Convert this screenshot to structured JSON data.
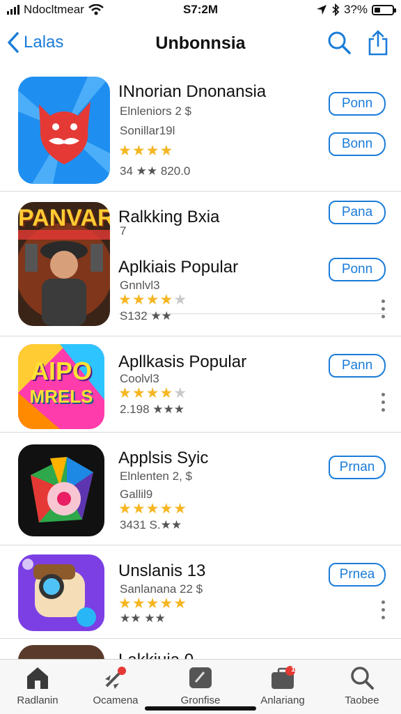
{
  "status": {
    "carrier": "Ndocltmear",
    "time": "S7:2M",
    "battery": "3?%",
    "battery_level": 0.35
  },
  "nav": {
    "back_label": "Lalas",
    "title": "Unbonnsia"
  },
  "apps": [
    {
      "title": "INnorian Dnonansia",
      "sub1": "Elnleniors 2 $",
      "sub2": "Sonillar19l",
      "stars": 3.5,
      "rating_text": "34 ★★ 820.0",
      "buttons": [
        "Ponn",
        "Bonn"
      ],
      "colors": [
        "#1e8ff0",
        "#e53935"
      ]
    },
    {
      "title": "Ralkking Bxia",
      "sub1": "7",
      "icon_text": "PANVAR",
      "buttons": [
        "Pana"
      ]
    },
    {
      "title": "Aplkiais Popular",
      "sub1": "Gnnlvl3",
      "stars": 4,
      "rating_text": "S132 ★★",
      "buttons": [
        "Ponn"
      ]
    },
    {
      "title": "Apllkasis Popular",
      "sub1": "Coolvl3",
      "stars": 3.5,
      "rating_text": "2.198 ★★★",
      "icon_text": "AIPO",
      "icon_text2": "MRELS",
      "buttons": [
        "Pann"
      ]
    },
    {
      "title": "Applsis Syic",
      "sub1": "Elnlenten 2, $",
      "sub2": "Gallil9",
      "stars": 5,
      "rating_text": "3431 S.★★",
      "buttons": [
        "Prnan"
      ]
    },
    {
      "title": "Unslanis 13",
      "sub1": "Sanlanana 22 $",
      "stars": 5,
      "rating_text": "★★ ★★",
      "buttons": [
        "Prnea"
      ]
    },
    {
      "title": "Lakkiuia 0"
    }
  ],
  "tabs": [
    {
      "label": "Radlanin",
      "icon": "home-icon"
    },
    {
      "label": "Ocamena",
      "icon": "rocket-icon"
    },
    {
      "label": "Gronfise",
      "icon": "games-icon"
    },
    {
      "label": "Anlariang",
      "icon": "briefcase-icon",
      "badge": "1"
    },
    {
      "label": "Taobee",
      "icon": "search-icon"
    }
  ]
}
